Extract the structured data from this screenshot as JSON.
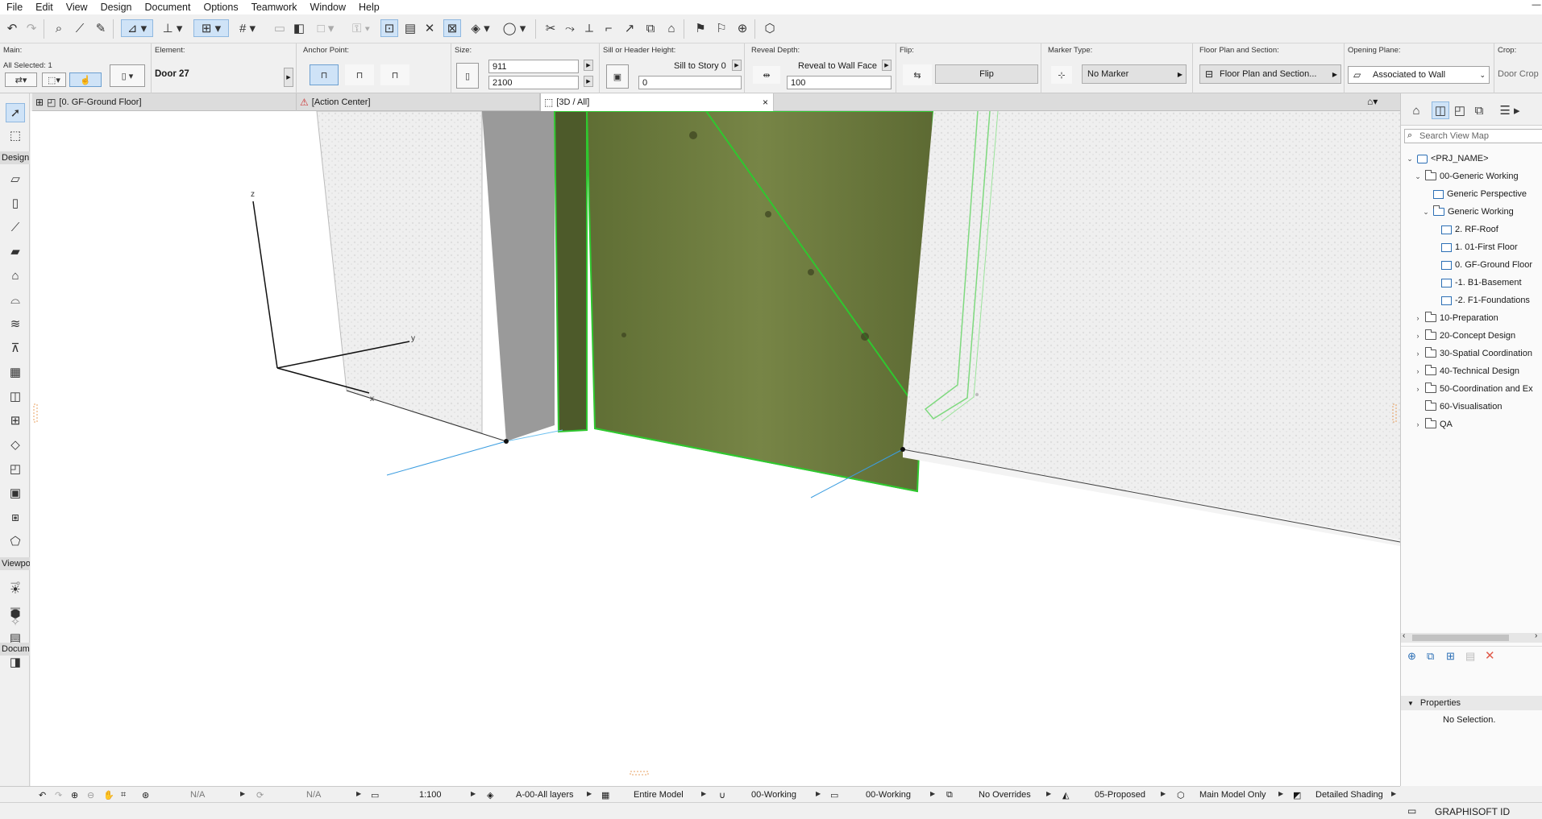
{
  "menu": [
    "File",
    "Edit",
    "View",
    "Design",
    "Document",
    "Options",
    "Teamwork",
    "Window",
    "Help"
  ],
  "window_controls": {
    "minimize": "—"
  },
  "infobox": {
    "main_label": "Main:",
    "all_selected": "All Selected: 1",
    "element_label": "Element:",
    "element_value": "Door 27",
    "anchor_label": "Anchor Point:",
    "size_label": "Size:",
    "width_value": "911",
    "height_value": "2100",
    "sill_label": "Sill or Header Height:",
    "sill_mode": "Sill to Story 0",
    "sill_value": "0",
    "reveal_label": "Reveal Depth:",
    "reveal_mode": "Reveal to Wall Face",
    "reveal_value": "100",
    "flip_label": "Flip:",
    "flip_button": "Flip",
    "marker_label": "Marker Type:",
    "marker_value": "No Marker",
    "plan_label": "Floor Plan and Section:",
    "plan_value": "Floor Plan and Section...",
    "opening_label": "Opening Plane:",
    "opening_value": "Associated to Wall",
    "crop_label": "Crop:",
    "crop_value": "Door Crop"
  },
  "tabs": [
    {
      "label": "[0. GF-Ground Floor]"
    },
    {
      "label": "[Action Center]"
    },
    {
      "label": "[3D / All]"
    }
  ],
  "tab_close": "×",
  "toolbox": {
    "design_header": "Design",
    "viewpoint_header": "Viewpoi",
    "document_header": "Docume"
  },
  "axes": {
    "x": "x",
    "y": "y",
    "z": "z"
  },
  "navigator": {
    "search_placeholder": "Search View Map",
    "tree": [
      {
        "label": "<PRJ_NAME>",
        "level": 0,
        "chev": "⌄",
        "icon": "project"
      },
      {
        "label": "00-Generic Working",
        "level": 1,
        "chev": "⌄",
        "icon": "folder"
      },
      {
        "label": "Generic Perspective",
        "level": 2,
        "chev": "",
        "icon": "view"
      },
      {
        "label": "Generic Working",
        "level": 2,
        "chev": "⌄",
        "icon": "viewset"
      },
      {
        "label": "2. RF-Roof",
        "level": 3,
        "chev": "",
        "icon": "view"
      },
      {
        "label": "1. 01-First Floor",
        "level": 3,
        "chev": "",
        "icon": "view"
      },
      {
        "label": "0. GF-Ground Floor",
        "level": 3,
        "chev": "",
        "icon": "view"
      },
      {
        "label": "-1. B1-Basement",
        "level": 3,
        "chev": "",
        "icon": "view"
      },
      {
        "label": "-2. F1-Foundations",
        "level": 3,
        "chev": "",
        "icon": "view"
      },
      {
        "label": "10-Preparation",
        "level": 1,
        "chev": "›",
        "icon": "folder"
      },
      {
        "label": "20-Concept Design",
        "level": 1,
        "chev": "›",
        "icon": "folder"
      },
      {
        "label": "30-Spatial Coordination",
        "level": 1,
        "chev": "›",
        "icon": "folder"
      },
      {
        "label": "40-Technical Design",
        "level": 1,
        "chev": "›",
        "icon": "folder"
      },
      {
        "label": "50-Coordination and Ex",
        "level": 1,
        "chev": "›",
        "icon": "folder"
      },
      {
        "label": "60-Visualisation",
        "level": 1,
        "chev": "",
        "icon": "folder"
      },
      {
        "label": "QA",
        "level": 1,
        "chev": "›",
        "icon": "folder"
      }
    ],
    "properties_header": "Properties",
    "properties_value": "No Selection."
  },
  "statusbar": {
    "na1": "N/A",
    "na2": "N/A",
    "scale": "1:100",
    "layers": "A-00-All layers",
    "model": "Entire Model",
    "renovation1": "00-Working",
    "renovation2": "00-Working",
    "overrides": "No Overrides",
    "phase": "05-Proposed",
    "model_only": "Main Model Only",
    "shading": "Detailed Shading"
  },
  "graphisoft": "GRAPHISOFT ID",
  "colors": {
    "selection_green": "#2fc72f",
    "wall": "#e9e9e9",
    "door": "#6b7a3a",
    "accent": "#2c6fb5"
  }
}
